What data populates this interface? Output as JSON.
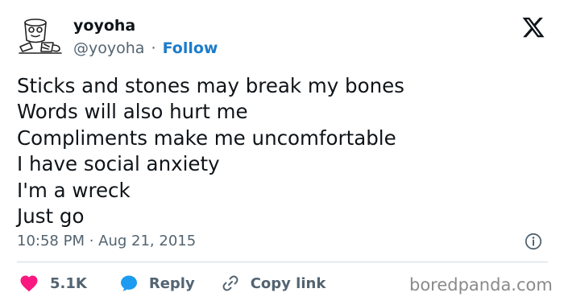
{
  "author": {
    "name": "yoyoha",
    "handle": "@yoyoha",
    "separator": "·",
    "follow_label": "Follow",
    "avatar_icon": "doodle-avatar-icon"
  },
  "platform_icon": "x-logo-icon",
  "tweet": {
    "lines": [
      "Sticks and stones may break my bones",
      "Words will also hurt me",
      "Compliments make me uncomfortable",
      "I have social anxiety",
      "I'm a wreck",
      "Just go"
    ],
    "timestamp": "10:58 PM · Aug 21, 2015"
  },
  "actions": {
    "likes_count": "5.1K",
    "reply_label": "Reply",
    "copy_link_label": "Copy link"
  },
  "watermark": "boredpanda.com",
  "colors": {
    "like_heart": "#f91880",
    "reply_bubble": "#1d9bf0",
    "follow_link": "#1d7cc9",
    "secondary_text": "#536471"
  }
}
